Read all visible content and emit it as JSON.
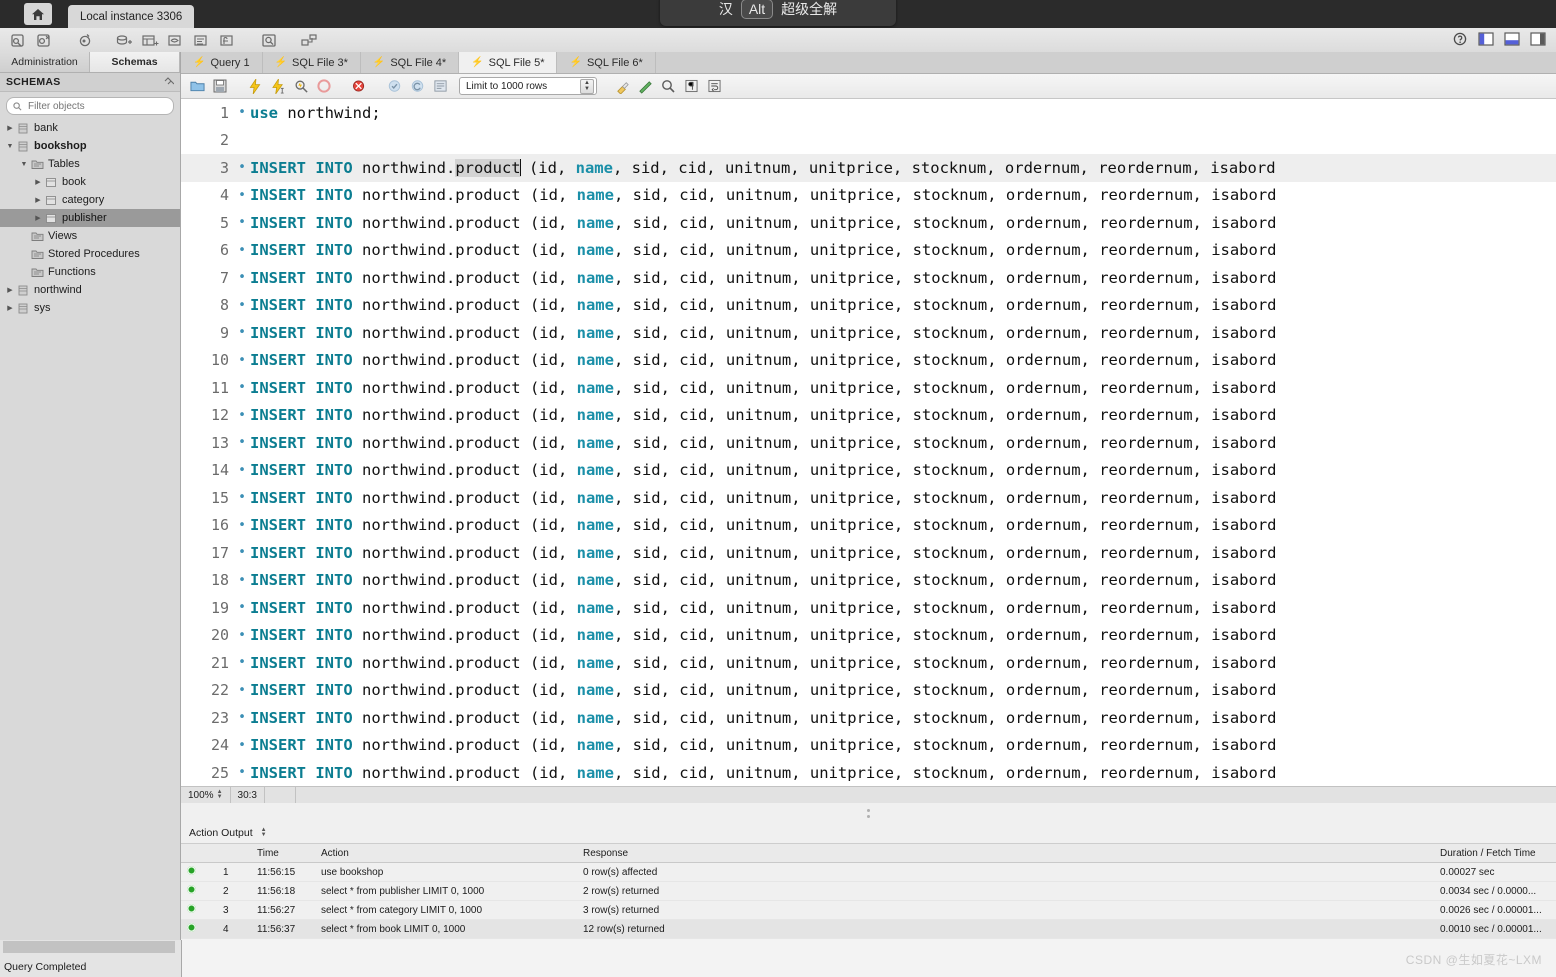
{
  "window": {
    "home_tooltip": "Home",
    "instance_tab": "Local instance 3306",
    "ime_pinyin": "汉",
    "ime_key": "Alt",
    "ime_label": "超级全解"
  },
  "main_toolbar": {
    "icons": [
      {
        "name": "new-sql-editor-icon",
        "glyph": "sql-new"
      },
      {
        "name": "open-sql-script-icon",
        "glyph": "sql-open"
      },
      {
        "name": "open-connection-icon",
        "glyph": "connect"
      },
      {
        "name": "new-schema-icon",
        "glyph": "schema"
      },
      {
        "name": "new-table-icon",
        "glyph": "table"
      },
      {
        "name": "new-view-icon",
        "glyph": "view"
      },
      {
        "name": "new-procedure-icon",
        "glyph": "proc"
      },
      {
        "name": "new-function-icon",
        "glyph": "func"
      },
      {
        "name": "search-table-data-icon",
        "glyph": "find"
      },
      {
        "name": "reverse-engineer-icon",
        "glyph": "revmodel"
      }
    ],
    "window_controls": [
      {
        "name": "help-icon",
        "glyph": "help"
      },
      {
        "name": "toggle-sidebar-icon",
        "glyph": "left-panel"
      },
      {
        "name": "toggle-output-panel-icon",
        "glyph": "bottom-panel"
      },
      {
        "name": "toggle-secondary-sidebar-icon",
        "glyph": "right-panel"
      }
    ]
  },
  "sidebar": {
    "tabs": [
      {
        "label": "Administration",
        "active": false
      },
      {
        "label": "Schemas",
        "active": true
      }
    ],
    "header": "SCHEMAS",
    "collapse_icon": "collapse-all-icon",
    "filter_placeholder": "Filter objects",
    "filter_value": "",
    "tree": [
      {
        "label": "bank",
        "depth": 0,
        "twisty": "collapsed",
        "icon": "schema-icon",
        "bold": false,
        "selected": false
      },
      {
        "label": "bookshop",
        "depth": 0,
        "twisty": "expanded",
        "icon": "schema-icon",
        "bold": true,
        "selected": false
      },
      {
        "label": "Tables",
        "depth": 1,
        "twisty": "expanded",
        "icon": "tables-folder-icon",
        "bold": false,
        "selected": false
      },
      {
        "label": "book",
        "depth": 2,
        "twisty": "collapsed",
        "icon": "table-icon",
        "bold": false,
        "selected": false
      },
      {
        "label": "category",
        "depth": 2,
        "twisty": "collapsed",
        "icon": "table-icon",
        "bold": false,
        "selected": false
      },
      {
        "label": "publisher",
        "depth": 2,
        "twisty": "collapsed",
        "icon": "table-icon",
        "bold": false,
        "selected": true
      },
      {
        "label": "Views",
        "depth": 1,
        "twisty": "none",
        "icon": "views-folder-icon",
        "bold": false,
        "selected": false
      },
      {
        "label": "Stored Procedures",
        "depth": 1,
        "twisty": "none",
        "icon": "procedures-folder-icon",
        "bold": false,
        "selected": false
      },
      {
        "label": "Functions",
        "depth": 1,
        "twisty": "none",
        "icon": "functions-folder-icon",
        "bold": false,
        "selected": false
      },
      {
        "label": "northwind",
        "depth": 0,
        "twisty": "collapsed",
        "icon": "schema-icon",
        "bold": false,
        "selected": false
      },
      {
        "label": "sys",
        "depth": 0,
        "twisty": "collapsed",
        "icon": "schema-icon",
        "bold": false,
        "selected": false
      }
    ]
  },
  "editor_tabs": [
    {
      "label": "Query 1",
      "active": false
    },
    {
      "label": "SQL File 3*",
      "active": false
    },
    {
      "label": "SQL File 4*",
      "active": false
    },
    {
      "label": "SQL File 5*",
      "active": true
    },
    {
      "label": "SQL File 6*",
      "active": false
    }
  ],
  "editor_toolbar": {
    "icons": [
      {
        "name": "open-sql-file-icon",
        "glyph": "folder"
      },
      {
        "name": "save-sql-file-icon",
        "glyph": "save"
      },
      {
        "name": "execute-statements-icon",
        "glyph": "bolt"
      },
      {
        "name": "execute-current-statement-icon",
        "glyph": "bolt-cursor"
      },
      {
        "name": "explain-statement-icon",
        "glyph": "magnifier-bolt"
      },
      {
        "name": "stop-execution-icon",
        "glyph": "stop"
      },
      {
        "name": "toggle-stop-on-error-icon",
        "glyph": "stop-error"
      },
      {
        "name": "commit-transaction-icon",
        "glyph": "commit"
      },
      {
        "name": "rollback-transaction-icon",
        "glyph": "rollback"
      },
      {
        "name": "toggle-autocommit-icon",
        "glyph": "autocommit"
      }
    ],
    "limit_label": "Limit to 1000 rows",
    "right_icons": [
      {
        "name": "beautify-sql-icon",
        "glyph": "brush"
      },
      {
        "name": "toggle-autocomplete-icon",
        "glyph": "wand"
      },
      {
        "name": "find-icon",
        "glyph": "search"
      },
      {
        "name": "toggle-invisible-chars-icon",
        "glyph": "para"
      },
      {
        "name": "wrap-lines-icon",
        "glyph": "wrap"
      }
    ]
  },
  "code": {
    "insert_prefix": "INSERT INTO",
    "table_ref_before": " northwind.",
    "table_ref_token": "product",
    "columns_head": " (id, ",
    "name_kw": "name",
    "columns_tail": ", sid, cid, unitnum, unitprice, stocknum, ordernum, reordernum, isabord",
    "line1": {
      "kw": "use",
      "rest": " northwind;"
    },
    "lines": [
      {
        "num": 1,
        "type": "use",
        "marker": true
      },
      {
        "num": 2,
        "type": "blank",
        "marker": false
      },
      {
        "num": 3,
        "type": "insert",
        "marker": true,
        "highlight": true,
        "selected_token": true
      },
      {
        "num": 4,
        "type": "insert",
        "marker": true
      },
      {
        "num": 5,
        "type": "insert",
        "marker": true
      },
      {
        "num": 6,
        "type": "insert",
        "marker": true
      },
      {
        "num": 7,
        "type": "insert",
        "marker": true
      },
      {
        "num": 8,
        "type": "insert",
        "marker": true
      },
      {
        "num": 9,
        "type": "insert",
        "marker": true
      },
      {
        "num": 10,
        "type": "insert",
        "marker": true
      },
      {
        "num": 11,
        "type": "insert",
        "marker": true
      },
      {
        "num": 12,
        "type": "insert",
        "marker": true
      },
      {
        "num": 13,
        "type": "insert",
        "marker": true
      },
      {
        "num": 14,
        "type": "insert",
        "marker": true
      },
      {
        "num": 15,
        "type": "insert",
        "marker": true
      },
      {
        "num": 16,
        "type": "insert",
        "marker": true
      },
      {
        "num": 17,
        "type": "insert",
        "marker": true
      },
      {
        "num": 18,
        "type": "insert",
        "marker": true
      },
      {
        "num": 19,
        "type": "insert",
        "marker": true
      },
      {
        "num": 20,
        "type": "insert",
        "marker": true
      },
      {
        "num": 21,
        "type": "insert",
        "marker": true
      },
      {
        "num": 22,
        "type": "insert",
        "marker": true
      },
      {
        "num": 23,
        "type": "insert",
        "marker": true
      },
      {
        "num": 24,
        "type": "insert",
        "marker": true
      },
      {
        "num": 25,
        "type": "insert",
        "marker": true
      }
    ]
  },
  "editor_status": {
    "zoom": "100%",
    "position": "30:3"
  },
  "output": {
    "panel_label": "Action Output",
    "columns": [
      "",
      "",
      "Time",
      "Action",
      "Response",
      "Duration / Fetch Time"
    ],
    "rows": [
      {
        "status": "ok",
        "num": "1",
        "time": "11:56:15",
        "action": "use bookshop",
        "response": "0 row(s) affected",
        "duration": "0.00027 sec"
      },
      {
        "status": "ok",
        "num": "2",
        "time": "11:56:18",
        "action": "select * from publisher LIMIT 0, 1000",
        "response": "2 row(s) returned",
        "duration": "0.0034 sec / 0.0000..."
      },
      {
        "status": "ok",
        "num": "3",
        "time": "11:56:27",
        "action": "select * from category LIMIT 0, 1000",
        "response": "3 row(s) returned",
        "duration": "0.0026 sec / 0.00001..."
      },
      {
        "status": "ok",
        "num": "4",
        "time": "11:56:37",
        "action": "select * from book LIMIT 0, 1000",
        "response": "12 row(s) returned",
        "duration": "0.0010 sec / 0.00001..."
      }
    ]
  },
  "status_bar": {
    "query_status": "Query Completed"
  },
  "watermark": "CSDN @生如夏花~LXM",
  "colors": {
    "keyword": "#0b7d91",
    "selection": "#d3d3d3",
    "line_highlight": "#eeeeee",
    "sidebar_bg": "#d9d9d9",
    "ok_green": "#27a327"
  }
}
